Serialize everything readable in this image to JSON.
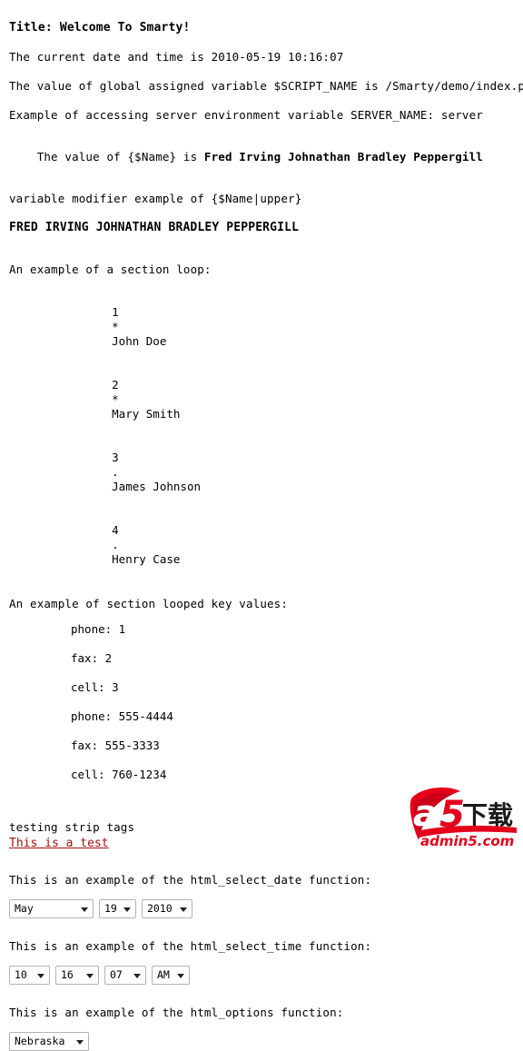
{
  "document": {
    "title_line": "Title: Welcome To Smarty!",
    "datetime_line": "The current date and time is 2010-05-19 10:16:07",
    "script_name_line": "The value of global assigned variable $SCRIPT_NAME is /Smarty/demo/index.php",
    "server_env_line": "Example of accessing server environment variable SERVER_NAME: server",
    "name_line_prefix": "The value of {$Name} is ",
    "name_value": "Fred Irving Johnathan Bradley Peppergill",
    "modifier_line": "variable modifier example of {$Name|upper}",
    "name_upper": "FRED IRVING JOHNATHAN BRADLEY PEPPERGILL",
    "section_loop_heading": "An example of a section loop:",
    "section_keys_heading": "An example of section looped key values:",
    "strip_tags_label": "testing strip tags",
    "test_link_text": "This is a test",
    "html_select_date_heading": "This is an example of the html_select_date function:",
    "html_select_time_heading": "This is an example of the html_select_time function:",
    "html_options_heading": "This is an example of the html_options function:"
  },
  "section_loop": [
    {
      "index": "1",
      "marker": "*",
      "name": "John Doe"
    },
    {
      "index": "2",
      "marker": "*",
      "name": "Mary Smith"
    },
    {
      "index": "3",
      "marker": ".",
      "name": "James Johnson"
    },
    {
      "index": "4",
      "marker": ".",
      "name": "Henry Case"
    }
  ],
  "section_keys": [
    "phone: 1",
    "fax: 2",
    "cell: 3",
    "phone: 555-4444",
    "fax: 555-3333",
    "cell: 760-1234"
  ],
  "select_date": {
    "month": "May",
    "day": "19",
    "year": "2010"
  },
  "select_time": {
    "hour": "10",
    "minute": "16",
    "second": "07",
    "meridian": "AM"
  },
  "select_options": {
    "state": "Nebraska"
  },
  "colors": {
    "link_red": "#a51010",
    "text_black": "#000000",
    "select_border": "#b3b3b3",
    "logo_red": "#e3001b",
    "logo_dark_red": "#b50016",
    "logo_black": "#1a1a1a"
  },
  "watermark": {
    "brand_mark": "a5",
    "brand_cn": "下载",
    "brand_domain": "admin5.com"
  }
}
